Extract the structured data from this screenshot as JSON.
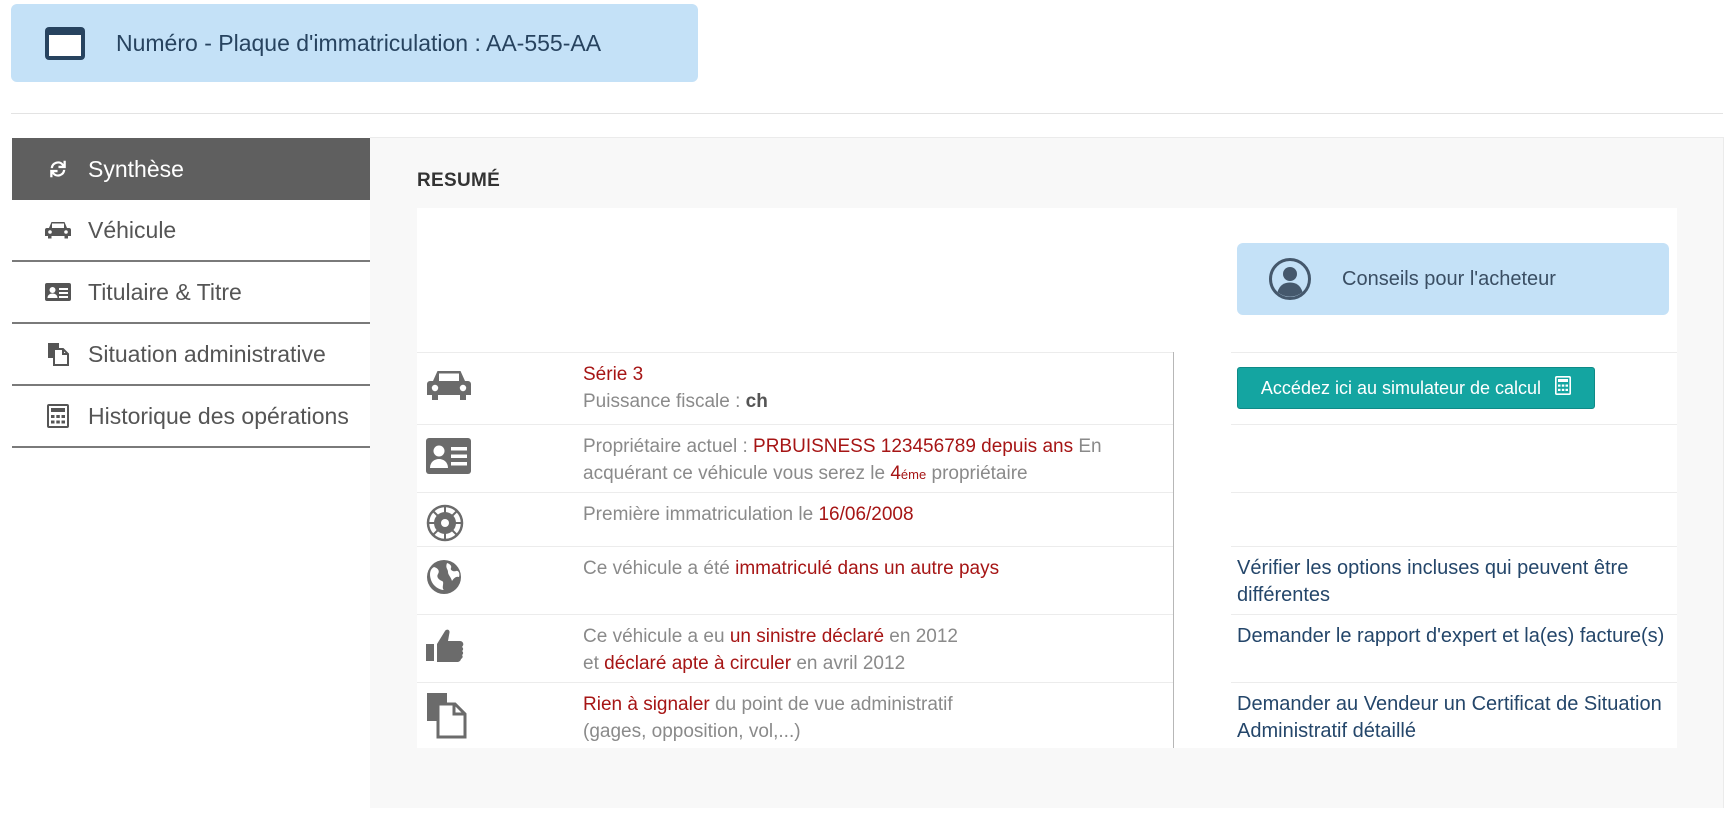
{
  "header": {
    "plate_title": "Numéro - Plaque d'immatriculation : AA-555-AA"
  },
  "sidebar": {
    "items": [
      {
        "label": "Synthèse",
        "icon": "refresh-icon",
        "active": true
      },
      {
        "label": "Véhicule",
        "icon": "car-icon",
        "active": false
      },
      {
        "label": "Titulaire & Titre",
        "icon": "id-card-icon",
        "active": false
      },
      {
        "label": "Situation administrative",
        "icon": "documents-icon",
        "active": false
      },
      {
        "label": "Historique des opérations",
        "icon": "calculator-icon",
        "active": false
      }
    ]
  },
  "main": {
    "section_title": "RESUMÉ",
    "advice_label": "Conseils pour l'acheteur",
    "rows": [
      {
        "icon": "car-icon",
        "model": "Série 3",
        "power_label": "Puissance fiscale : ",
        "power_value": "ch",
        "action_button": "Accédez ici au simulateur de calcul"
      },
      {
        "icon": "id-card-icon",
        "owner_prefix": "Propriétaire actuel : ",
        "owner_value": "PRBUISNESS 123456789 depuis ans",
        "owner_mid": " En acquérant ce véhicule vous serez le ",
        "owner_rank": "4",
        "owner_rank_sup": "éme",
        "owner_suffix": " propriétaire"
      },
      {
        "icon": "seal-icon",
        "prefix": "Première immatriculation le ",
        "date": "16/06/2008"
      },
      {
        "icon": "globe-icon",
        "prefix": "Ce véhicule a été ",
        "highlight": "immatriculé dans un autre pays",
        "action": "Vérifier les options incluses qui peuvent être différentes"
      },
      {
        "icon": "thumbs-up-icon",
        "prefix": "Ce véhicule a eu ",
        "highlight1": "un sinistre déclaré",
        "mid1": " en 2012",
        "mid2": "et ",
        "highlight2": "déclaré apte à circuler",
        "suffix": " en avril 2012",
        "action": "Demander le rapport d'expert et la(es) facture(s)"
      },
      {
        "icon": "documents-icon",
        "highlight": "Rien à signaler",
        "suffix": " du point de vue administratif",
        "line2": "(gages, opposition, vol,...)",
        "action": "Demander au Vendeur un Certificat de Situation Administratif détaillé"
      }
    ]
  },
  "colors": {
    "banner_bg": "#c4e1f7",
    "active_nav_bg": "#5f5f5f",
    "accent_red": "#a61515",
    "link_blue": "#24466a",
    "button_teal": "#14a5a1"
  }
}
